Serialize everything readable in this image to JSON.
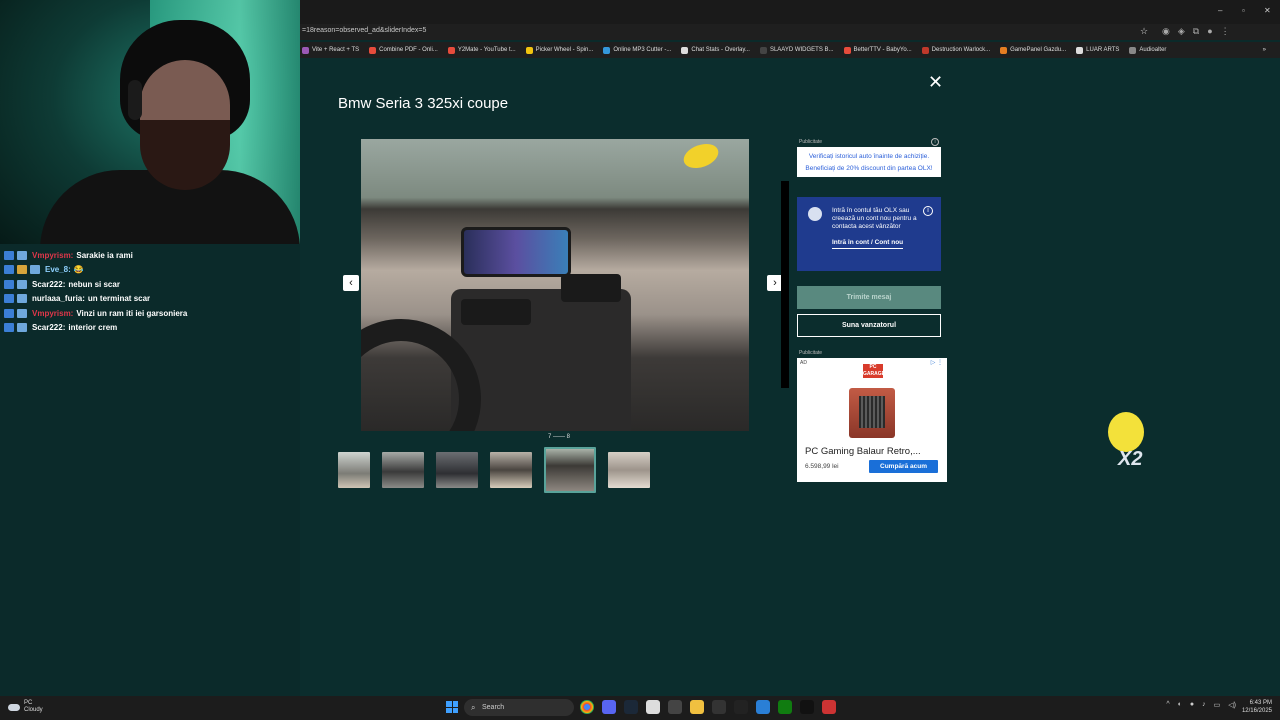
{
  "browser": {
    "url": "=18reason=observed_ad&sliderIndex=5",
    "bookmarks": [
      "Vite + React + TS",
      "Combine PDF - Onli...",
      "Y2Mate - YouTube t...",
      "Picker Wheel - Spin...",
      "Online MP3 Cutter -...",
      "Chat Stats - Overlay...",
      "SLAAYD WIDGETS B...",
      "BetterTTV - BabyYo...",
      "Destruction Warlock...",
      "GamePanel Gazdu...",
      "LUAR ARTS",
      "Audioalter"
    ],
    "window_controls": [
      "–",
      "▫",
      "✕"
    ],
    "bookmarks_more": "»"
  },
  "chat": {
    "messages": [
      {
        "user": "Vmpyrism:",
        "user_color": "#e0374a",
        "text": "Sarakie ia rami"
      },
      {
        "user": "Eve_8:",
        "user_color": "#8fd1ff",
        "text": "😂"
      },
      {
        "user": "Scar222:",
        "user_color": "#ffffff",
        "text": "nebun si scar"
      },
      {
        "user": "nurlaaa_furia:",
        "user_color": "#ffffff",
        "text": "un terminat scar"
      },
      {
        "user": "Vmpyrism:",
        "user_color": "#e0374a",
        "text": "Vinzi un ram iti iei garsoniera"
      },
      {
        "user": "Scar222:",
        "user_color": "#ffffff",
        "text": "interior crem"
      }
    ]
  },
  "modal": {
    "title": "Bmw Seria 3 325xi coupe",
    "close_icon": "✕",
    "prev_icon": "‹",
    "next_icon": "›",
    "counter": "7 —— 8",
    "thumbnail_count": 6,
    "selected_thumbnail": 5
  },
  "side": {
    "ad_label": "Publicitate",
    "history_line1": "Verificați istoricul auto înainte de achiziție.",
    "history_line2": "Beneficiați de 20% discount din partea OLX!",
    "login_text": "Intră în contul tău OLX sau creează un cont nou pentru a contacta acest vânzător",
    "login_link": "Intră în cont / Cont nou",
    "send_button": "Trimite mesaj",
    "call_button": "Suna vanzatorul",
    "ad_label2": "Publicitate",
    "product": {
      "tag": "AD",
      "brand": "PC GARAGE",
      "name": "PC Gaming Balaur Retro,...",
      "price": "6.598,99 lei",
      "buy": "Cumpără acum"
    }
  },
  "overlay": {
    "multiplier": "X2"
  },
  "taskbar": {
    "weather_label": "PC",
    "weather_state": "Cloudy",
    "search_placeholder": "Search",
    "time": "6:43 PM",
    "date": "12/16/2025"
  },
  "colors": {
    "modal_bg": "#0b2d2d",
    "accent": "#1a6fd8",
    "login_bg": "#1f3b8e"
  }
}
